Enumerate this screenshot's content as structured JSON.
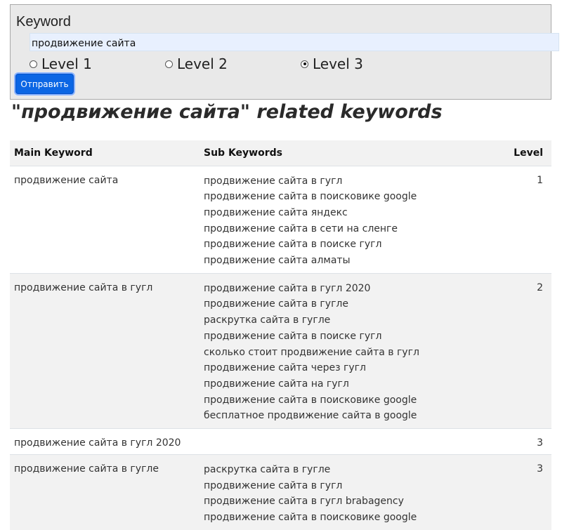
{
  "form": {
    "label": "Keyword",
    "input_value": "продвижение сайта",
    "radios": [
      {
        "label": "Level 1",
        "checked": false
      },
      {
        "label": "Level 2",
        "checked": false
      },
      {
        "label": "Level 3",
        "checked": true
      }
    ],
    "submit_label": "Отправить"
  },
  "heading": "\"продвижение сайта\" related keywords",
  "table": {
    "headers": [
      "Main Keyword",
      "Sub Keywords",
      "Level"
    ],
    "rows": [
      {
        "main": "продвижение сайта",
        "subs": [
          "продвижение сайта в гугл",
          "продвижение сайта в поисковике google",
          "продвижение сайта яндекс",
          "продвижение сайта в сети на сленге",
          "продвижение сайта в поиске гугл",
          "продвижение сайта алматы"
        ],
        "level": "1"
      },
      {
        "main": "продвижение сайта в гугл",
        "subs": [
          "продвижение сайта в гугл 2020",
          "продвижение сайта в гугле",
          "раскрутка сайта в гугле",
          "продвижение сайта в поиске гугл",
          "сколько стоит продвижение сайта в гугл",
          "продвижение сайта через гугл",
          "продвижение сайта на гугл",
          "продвижение сайта в поисковике google",
          "бесплатное продвижение сайта в google"
        ],
        "level": "2"
      },
      {
        "main": "продвижение сайта в гугл 2020",
        "subs": [],
        "level": "3"
      },
      {
        "main": "продвижение сайта в гугле",
        "subs": [
          "раскрутка сайта в гугле",
          "продвижение сайта в гугл",
          "продвижение сайта в гугл brabagency",
          "продвижение сайта в поисковике google"
        ],
        "level": "3"
      }
    ]
  }
}
